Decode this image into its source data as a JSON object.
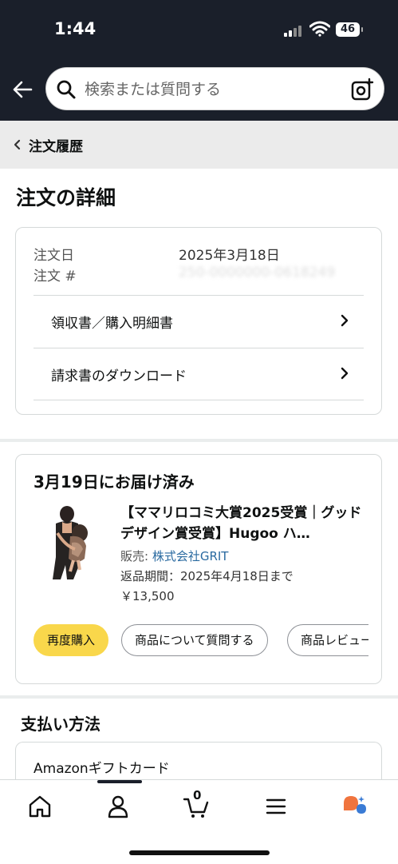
{
  "status_bar": {
    "time": "1:44",
    "battery": "46"
  },
  "search": {
    "placeholder": "検索または質問する"
  },
  "breadcrumb": {
    "label": "注文履歴"
  },
  "page_title": "注文の詳細",
  "order_info": {
    "date_label": "注文日",
    "date_value": "2025年3月18日",
    "number_label": "注文 #",
    "number_value": "250-0000000-0618249",
    "links": [
      "領収書／購入明細書",
      "請求書のダウンロード"
    ]
  },
  "shipment": {
    "status": "3月19日にお届け済み",
    "product_title": "【ママリロコミ大賞2025受賞｜グッドデザイン賞受賞】Hugoo ハ…",
    "seller_label": "販売: ",
    "seller_name": "株式会社GRIT",
    "return_period": "返品期間：2025年4月18日まで",
    "price": "￥13,500",
    "buttons": [
      "再度購入",
      "商品について質問する",
      "商品レビュー"
    ]
  },
  "payment": {
    "title": "支払い方法",
    "method": "Amazonギフトカード"
  },
  "nav": {
    "cart_count": "0"
  },
  "colors": {
    "header_bg": "#1a1f2a",
    "accent_yellow": "#f9d74b",
    "link_blue": "#2a6aa0",
    "rufus_orange": "#f0743e",
    "rufus_blue": "#3a7bd5"
  }
}
